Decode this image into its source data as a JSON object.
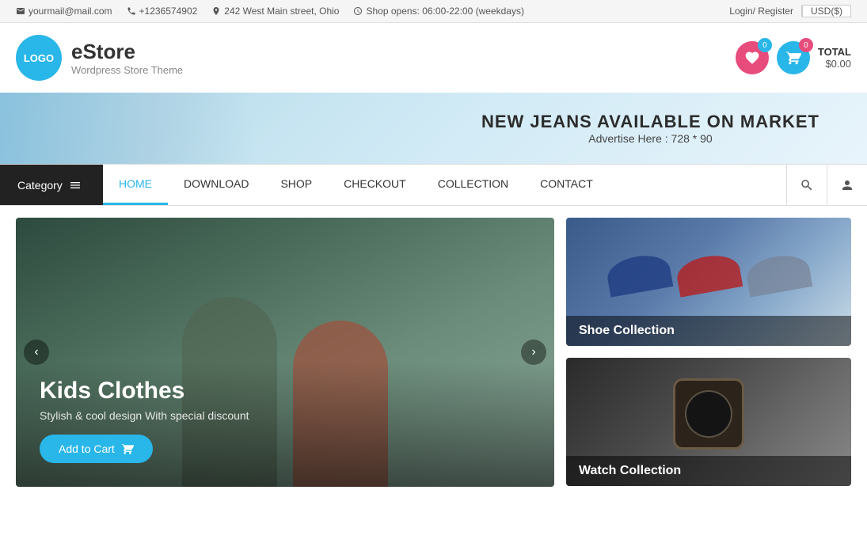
{
  "topbar": {
    "email": "yourmail@mail.com",
    "phone": "+1236574902",
    "address": "242 West Main street, Ohio",
    "hours": "Shop opens: 06:00-22:00 (weekdays)",
    "login_label": "Login/ Register",
    "currency_label": "USD($)"
  },
  "header": {
    "logo_text": "LOGO",
    "store_name": "eStore",
    "store_tagline": "Wordpress Store Theme",
    "wishlist_count": "0",
    "cart_count": "0",
    "total_label": "TOTAL",
    "total_amount": "$0.00"
  },
  "banner": {
    "title": "NEW JEANS AVAILABLE ON MARKET",
    "subtitle": "Advertise Here : 728 * 90"
  },
  "nav": {
    "category_label": "Category",
    "links": [
      {
        "label": "HOME",
        "active": true
      },
      {
        "label": "DOWNLOAD",
        "active": false
      },
      {
        "label": "SHOP",
        "active": false
      },
      {
        "label": "CHECKOUT",
        "active": false
      },
      {
        "label": "COLLECTION",
        "active": false
      },
      {
        "label": "CONTACT",
        "active": false
      }
    ]
  },
  "slider": {
    "title": "Kids Clothes",
    "subtitle": "Stylish & cool design With special discount",
    "btn_label": "Add to Cart"
  },
  "panels": [
    {
      "label": "Shoe Collection"
    },
    {
      "label": "Watch Collection"
    }
  ]
}
